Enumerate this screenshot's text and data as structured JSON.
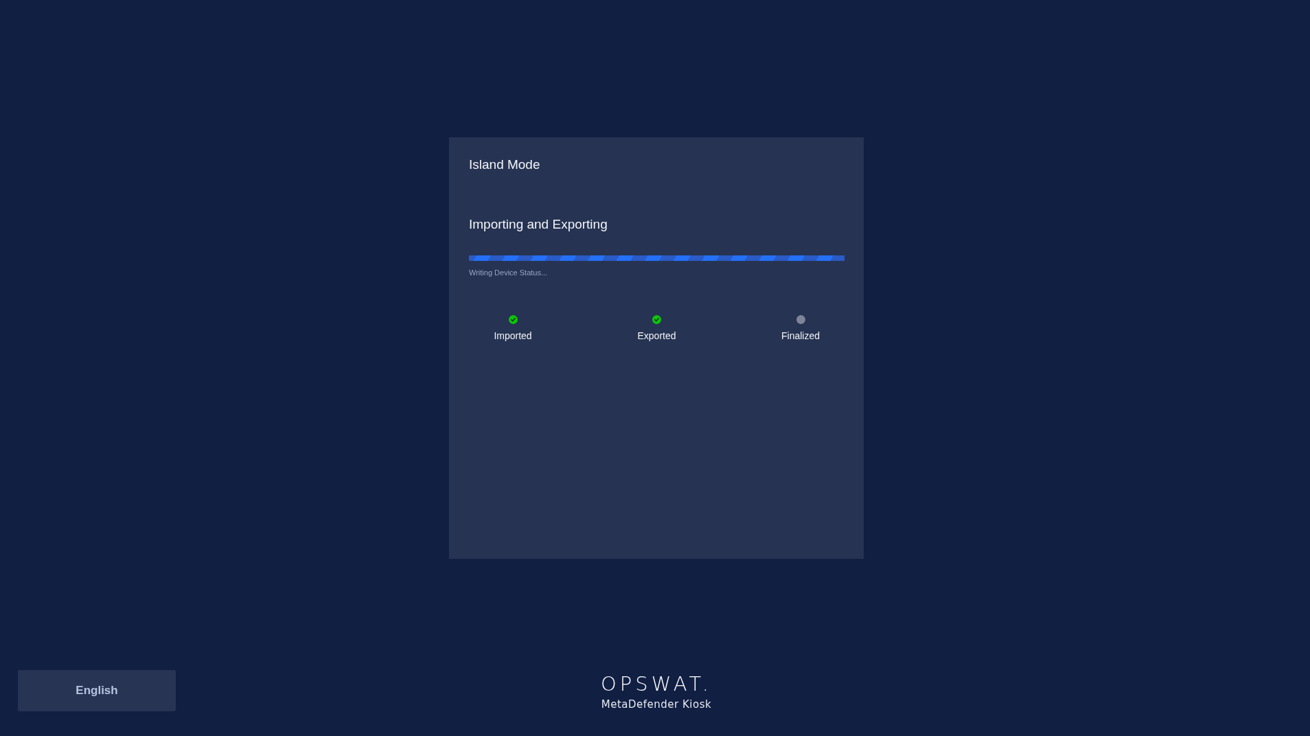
{
  "card": {
    "title": "Island Mode",
    "heading": "Importing and Exporting",
    "progress": {
      "level": 1,
      "status": "Writing Device Status..."
    },
    "steps": [
      {
        "label": "Imported",
        "completed": true
      },
      {
        "label": "Exported",
        "completed": true
      },
      {
        "label": "Finalized",
        "completed": false
      }
    ]
  },
  "language_button": {
    "label": "English"
  },
  "brand": {
    "logo": "OPSWAT.",
    "product": "MetaDefender Kiosk"
  }
}
